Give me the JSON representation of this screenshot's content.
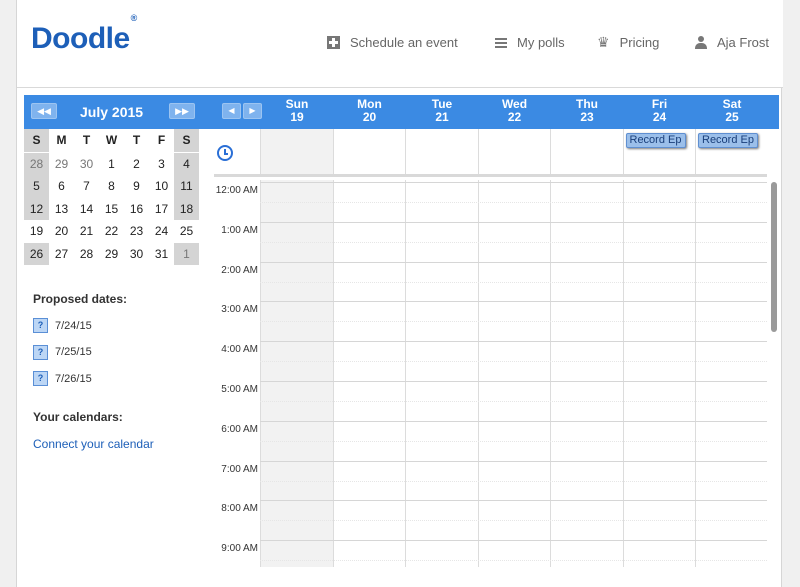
{
  "header": {
    "logo": "Doodle",
    "logo_mark": "®",
    "nav": [
      {
        "label": "Schedule an event",
        "icon": "plus-icon"
      },
      {
        "label": "My polls",
        "icon": "list-icon"
      },
      {
        "label": "Pricing",
        "icon": "crown-icon"
      },
      {
        "label": "Aja Frost",
        "icon": "user-icon"
      }
    ]
  },
  "minical": {
    "title": "July 2015",
    "prev": "◀◀",
    "next": "▶▶",
    "dow": [
      "S",
      "M",
      "T",
      "W",
      "T",
      "F",
      "S"
    ],
    "weeks": [
      [
        "28",
        "29",
        "30",
        "1",
        "2",
        "3",
        "4"
      ],
      [
        "5",
        "6",
        "7",
        "8",
        "9",
        "10",
        "11"
      ],
      [
        "12",
        "13",
        "14",
        "15",
        "16",
        "17",
        "18"
      ],
      [
        "19",
        "20",
        "21",
        "22",
        "23",
        "24",
        "25"
      ],
      [
        "26",
        "27",
        "28",
        "29",
        "30",
        "31",
        "1"
      ]
    ]
  },
  "week": {
    "prev": "◀",
    "next": "▶",
    "days": [
      {
        "name": "Sun",
        "num": "19"
      },
      {
        "name": "Mon",
        "num": "20"
      },
      {
        "name": "Tue",
        "num": "21"
      },
      {
        "name": "Wed",
        "num": "22"
      },
      {
        "name": "Thu",
        "num": "23"
      },
      {
        "name": "Fri",
        "num": "24"
      },
      {
        "name": "Sat",
        "num": "25"
      }
    ],
    "events": [
      {
        "label": "Record Ep",
        "day": 5
      },
      {
        "label": "Record Ep",
        "day": 6
      }
    ],
    "hours": [
      "12:00 AM",
      "1:00 AM",
      "2:00 AM",
      "3:00 AM",
      "4:00 AM",
      "5:00 AM",
      "6:00 AM",
      "7:00 AM",
      "8:00 AM",
      "9:00 AM"
    ]
  },
  "sidebar": {
    "proposed_title": "Proposed dates:",
    "proposed": [
      "7/24/15",
      "7/25/15",
      "7/26/15"
    ],
    "proposed_badge": "?",
    "calendars_title": "Your calendars:",
    "connect_link": "Connect your calendar"
  }
}
